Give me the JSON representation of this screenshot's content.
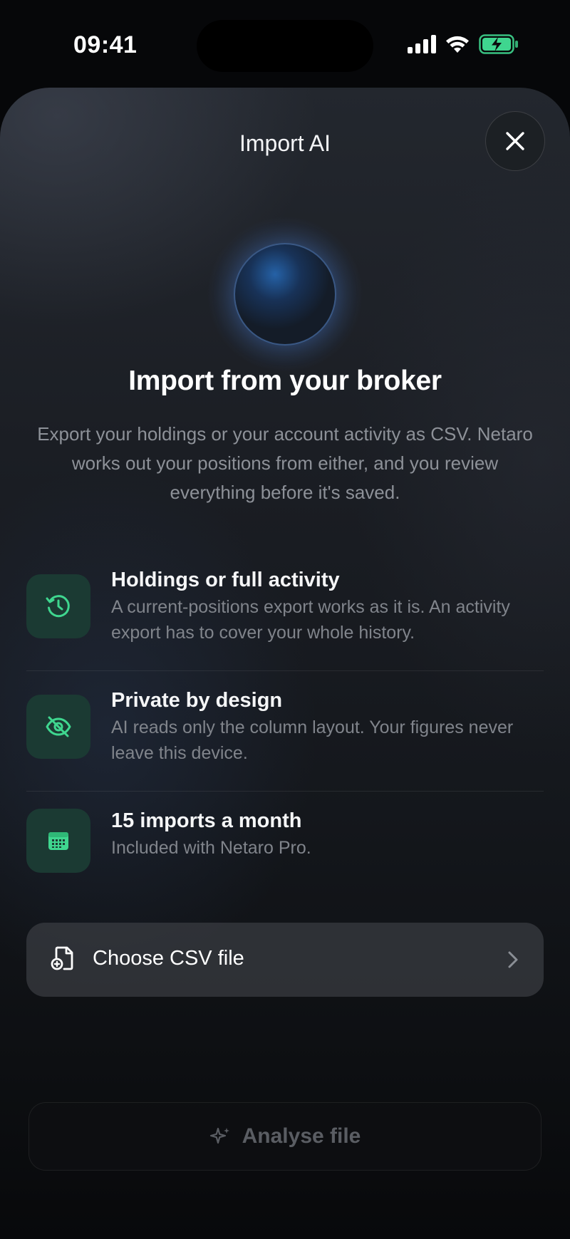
{
  "status_bar": {
    "time": "09:41",
    "icons": [
      "cellular-signal-icon",
      "wifi-icon",
      "battery-charging-icon"
    ]
  },
  "sheet": {
    "title": "Import AI",
    "close_icon": "close-icon",
    "headline": "Import from your broker",
    "intro": "Export your holdings or your account activity as CSV. Netaro works out your positions from either, and you review everything before it's saved.",
    "features": [
      {
        "icon": "history-clock-icon",
        "title": "Holdings or full activity",
        "description": "A current-positions export works as it is. An activity export has to cover your whole history."
      },
      {
        "icon": "eye-slash-icon",
        "title": "Private by design",
        "description": "AI reads only the column layout. Your figures never leave this device."
      },
      {
        "icon": "calendar-icon",
        "title": "15 imports a month",
        "description": "Included with Netaro Pro."
      }
    ],
    "choose_file": {
      "label": "Choose CSV file",
      "icon": "file-icon",
      "chevron": "chevron-right-icon"
    },
    "analyse": {
      "label": "Analyse file",
      "icon": "sparkle-icon"
    }
  },
  "colors": {
    "accent_green": "#3fd68f",
    "icon_tile": "#1b3a33",
    "sheet_background": "#1a1d23",
    "muted_text": "#8d9198"
  }
}
